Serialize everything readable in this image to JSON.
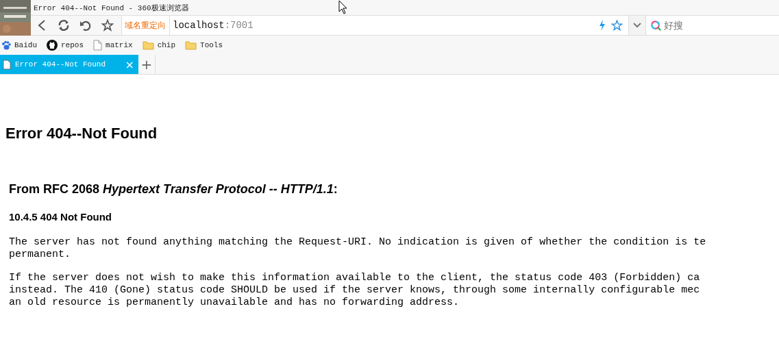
{
  "window": {
    "title": "Error 404--Not Found - 360极速浏览器"
  },
  "toolbar": {
    "redirect_label": "域名重定向",
    "address": {
      "host": "localhost",
      "port": ":7001"
    },
    "search": {
      "placeholder": "好搜"
    }
  },
  "bookmarks": [
    {
      "label": "Baidu",
      "kind": "paw"
    },
    {
      "label": "repos",
      "kind": "github"
    },
    {
      "label": "matrix",
      "kind": "page"
    },
    {
      "label": "chip",
      "kind": "folder"
    },
    {
      "label": "Tools",
      "kind": "folder"
    }
  ],
  "tabs": [
    {
      "title": "Error 404--Not Found",
      "selected": true,
      "close": "×"
    }
  ],
  "new_tab": "+",
  "page": {
    "heading": "Error 404--Not Found",
    "subheading": "From RFC 2068 *Hypertext Transfer Protocol -- HTTP/1.1*:",
    "section": "10.4.5 404 Not Found",
    "paragraphs": [
      [
        "The server has not found anything matching the Request-URI. No indication is given of whether the condition is te",
        "permanent."
      ],
      [
        "If the server does not wish to make this information available to the client, the status code 403 (Forbidden) ca",
        "instead. The 410 (Gone) status code SHOULD be used if the server knows, through some internally configurable mec",
        "an old resource is permanently unavailable and has no forwarding address."
      ]
    ]
  }
}
